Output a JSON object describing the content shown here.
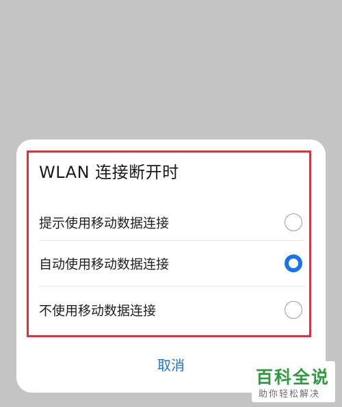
{
  "dialog": {
    "title": "WLAN 连接断开时",
    "options": [
      {
        "label": "提示使用移动数据连接",
        "checked": false
      },
      {
        "label": "自动使用移动数据连接",
        "checked": true
      },
      {
        "label": "不使用移动数据连接",
        "checked": false
      }
    ],
    "cancel_label": "取消"
  },
  "watermark": {
    "title": "百科全说",
    "subtitle": "助你轻松解决"
  },
  "colors": {
    "accent": "#1a73e8",
    "highlight_border": "#e0303a",
    "watermark_green": "#2e9a3e",
    "backdrop": "#c4c4c4"
  }
}
